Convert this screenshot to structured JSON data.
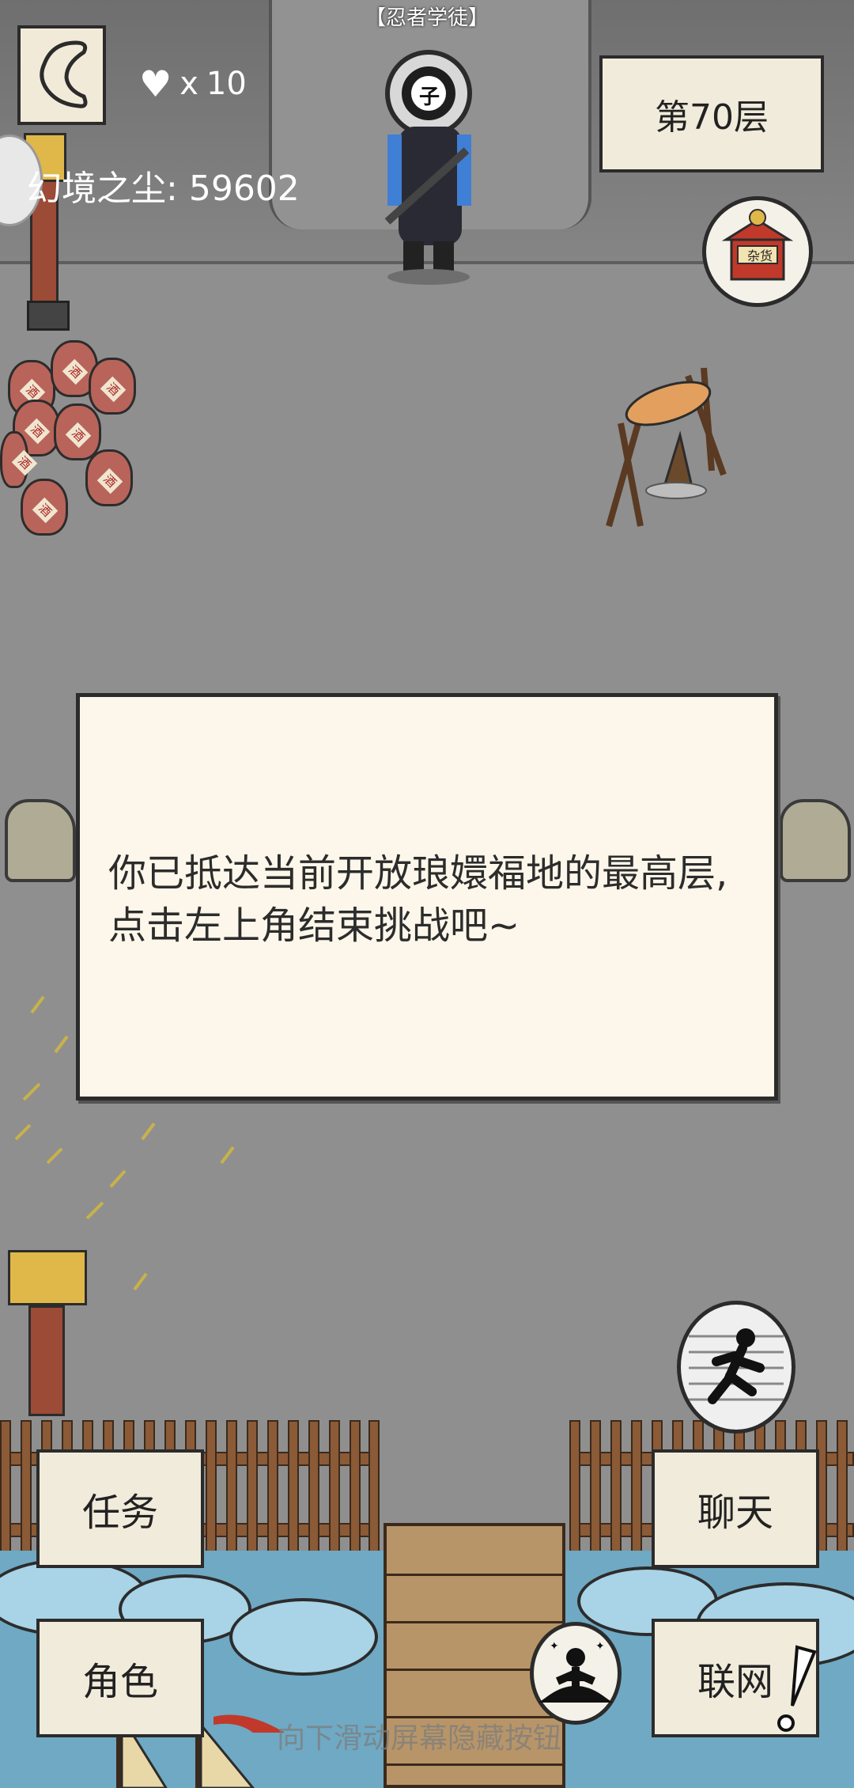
{
  "hud": {
    "character_title": "【忍者学徒】",
    "lives_prefix": "x",
    "lives_count": "10",
    "dust_label": "幻境之尘:",
    "dust_value": "59602",
    "floor_label": "第70层"
  },
  "character": {
    "badge_char": "子"
  },
  "shop": {
    "label": "杂货"
  },
  "jar_label": "酒",
  "dialog": {
    "message": "你已抵达当前开放琅嬛福地的最高层,点击左上角结束挑战吧~"
  },
  "buttons": {
    "task": "任务",
    "character": "角色",
    "chat": "聊天",
    "network": "联网"
  },
  "hint": "向下滑动屏幕隐藏按钮",
  "colors": {
    "panel_bg": "#f1ebdb",
    "dialog_bg": "#fcf7ea",
    "ground": "#8f8f8f",
    "water": "#6fa9c4"
  }
}
